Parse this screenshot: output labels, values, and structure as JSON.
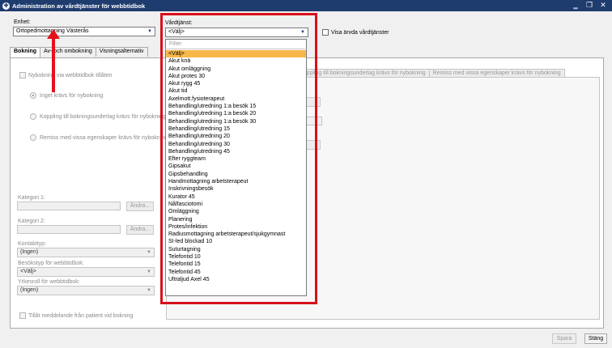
{
  "window": {
    "title": "Administration av vårdtjänster för webbtidbok",
    "controls": [
      "‗",
      "❐",
      "✕"
    ]
  },
  "enhet": {
    "label": "Enhet:",
    "value": "Ortopedmottagning Västerås"
  },
  "vardtjanst": {
    "label": "Vårdtjänst:",
    "value": "<Välj>",
    "filter_placeholder": "Filter",
    "options": [
      "<Välj>",
      "Akut knä",
      "Akut omläggning",
      "Akut protes 30",
      "Akut rygg 45",
      "Akut tid",
      "Axelmott.fysioterapeut",
      "Behandling/utredning 1:a besök 15",
      "Behandling/utredning 1:a besök 20",
      "Behandling/utredning 1:a besök 30",
      "Behandling/utredning 15",
      "Behandling/utredning 20",
      "Behandling/utredning 30",
      "Behandling/utredning 45",
      "Efter ryggteam",
      "Gipsakut",
      "Gipsbehandling",
      "Handmottagning arbetsterapeut",
      "Inskrivningsbesök",
      "Kurator 45",
      "Nålfasciotomi",
      "Omläggning",
      "Planering",
      "Protes/infektion",
      "Radiusmottagning arbetsterapeut/sjukgymnast",
      "SI-led blockad 10",
      "Suturtagning",
      "Telefontid 10",
      "Telefontid 15",
      "Telefontid 45",
      "Ultraljud Axel 45"
    ],
    "selected_index": 0
  },
  "visa_arvda": {
    "label": "Visa ärvda vårdtjänster"
  },
  "tabs": [
    "Bokning",
    "Av- och ombokning",
    "Visningsalternativ"
  ],
  "bokning": {
    "nybokning_label": "Nybokning via webbtidbok tillåten",
    "radio_options": [
      "Inget krävs för nybokning",
      "Koppling till bokningsunderlag krävs för nybokning",
      "Remiss med vissa egenskaper krävs för nybokning"
    ],
    "kategori1_label": "Kategori 1:",
    "kategori2_label": "Kategori 2:",
    "andra_label": "Ändra...",
    "kontakttyp_label": "Kontakttyp:",
    "kontakttyp_value": "(Ingen)",
    "besokstyp_label": "Besökstyp för webbtidbok:",
    "besokstyp_value": "<Välj>",
    "yrkesroll_label": "Yrkesroll för webbtidbok:",
    "yrkesroll_value": "(Ingen)",
    "tillat_label": "Tillåt meddelande från patient vid bokning"
  },
  "right_subtabs": [
    "Koppling till bokningsunderlag krävs för nybokning",
    "Remiss med vissa egenskaper krävs för nybokning"
  ],
  "footer": {
    "spara_label": "Spara",
    "stang_label": "Stäng"
  },
  "colors": {
    "titlebar": "#1f3c6e",
    "highlight": "#d8101b",
    "selected_option": "#f7b84b",
    "arrow": "#e3121c"
  }
}
